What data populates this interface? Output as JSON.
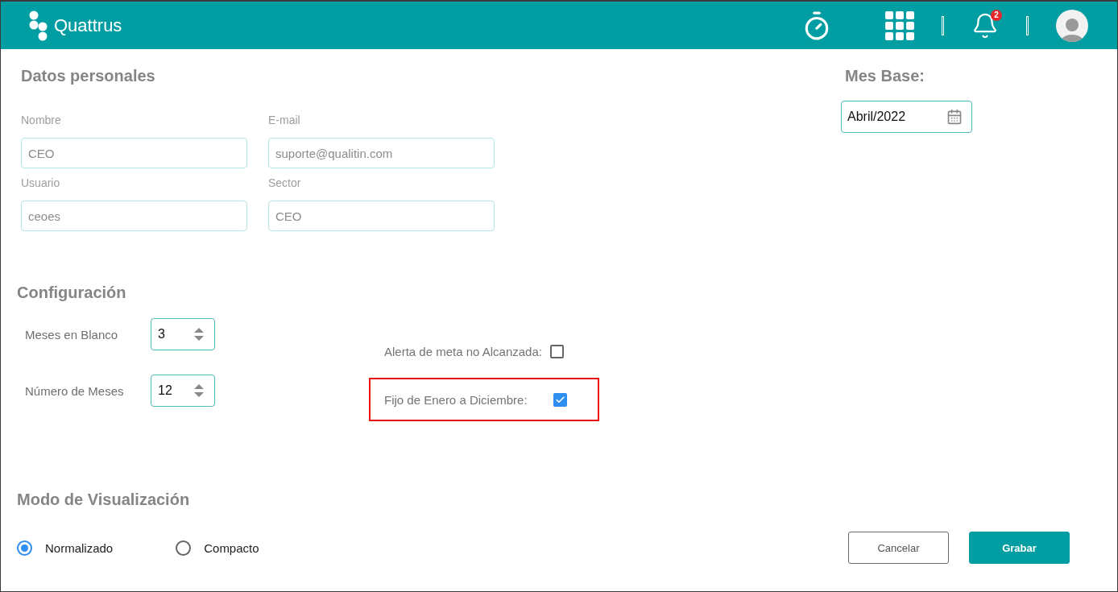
{
  "header": {
    "logo": "Quattrus",
    "notification_count": "2"
  },
  "personal": {
    "title": "Datos personales",
    "fields": [
      {
        "label": "Nombre",
        "value": "CEO",
        "disabled": true
      },
      {
        "label": "E-mail",
        "value": "suporte@qualitin.com",
        "disabled": true
      },
      {
        "label": "Usuario",
        "value": "ceoes",
        "disabled": true
      },
      {
        "label": "Sector",
        "value": "CEO",
        "disabled": true
      }
    ]
  },
  "base_month": {
    "label": "Mes Base:",
    "value": "Abril/2022"
  },
  "config": {
    "title": "Configuración",
    "spinners": [
      {
        "label": "Meses en Blanco",
        "value": "3"
      },
      {
        "label": "Número de Meses",
        "value": "12"
      }
    ],
    "checks": [
      {
        "label": "Alerta de meta no Alcanzada:",
        "checked": false,
        "highlighted": false
      },
      {
        "label": "Fijo de Enero a Diciembre:",
        "checked": true,
        "highlighted": true
      }
    ]
  },
  "view_mode": {
    "title": "Modo de Visualización",
    "options": [
      {
        "label": "Normalizado",
        "selected": true
      },
      {
        "label": "Compacto",
        "selected": false
      }
    ]
  },
  "buttons": [
    {
      "label": "Cancelar",
      "kind": "secondary"
    },
    {
      "label": "Grabar",
      "kind": "primary"
    }
  ]
}
